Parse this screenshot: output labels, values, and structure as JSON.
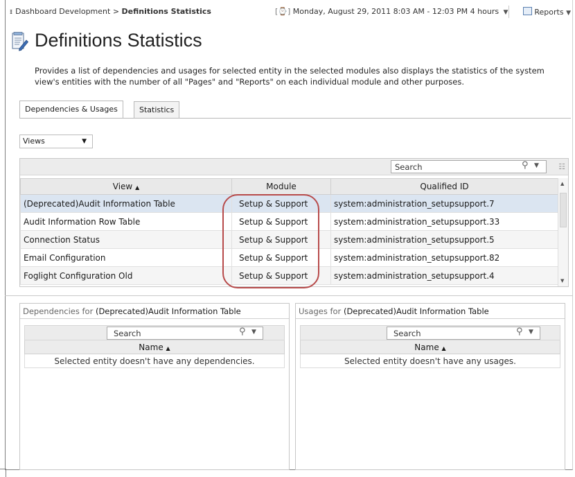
{
  "breadcrumb": {
    "parent": "Dashboard Development",
    "separator": ">",
    "current": "Definitions Statistics",
    "icon": "breadcrumb-tree-icon"
  },
  "time_range": {
    "icon": "clock-icon",
    "text": "Monday, August 29, 2011 8:03 AM - 12:03 PM 4 hours"
  },
  "reports": {
    "icon": "reports-icon",
    "label": "Reports"
  },
  "page": {
    "icon": "definitions-report-icon",
    "title": "Definitions Statistics",
    "description": "Provides a list of dependencies and usages for selected entity in the selected modules also displays the statistics of the system view's entities with the number of all \"Pages\" and \"Reports\" on each individual module and other purposes."
  },
  "tabs": [
    {
      "label": "Dependencies & Usages",
      "active": true
    },
    {
      "label": "Statistics",
      "active": false
    }
  ],
  "views_select": {
    "value": "Views"
  },
  "main_grid": {
    "search_placeholder": "Search",
    "columns": [
      "View",
      "Module",
      "Qualified ID"
    ],
    "sort_column": "View",
    "rows": [
      {
        "view": "(Deprecated)Audit Information Table",
        "module": "Setup & Support",
        "qid": "system:administration_setupsupport.7"
      },
      {
        "view": "Audit Information Row Table",
        "module": "Setup & Support",
        "qid": "system:administration_setupsupport.33"
      },
      {
        "view": "Connection Status",
        "module": "Setup & Support",
        "qid": "system:administration_setupsupport.5"
      },
      {
        "view": "Email Configuration",
        "module": "Setup & Support",
        "qid": "system:administration_setupsupport.82"
      },
      {
        "view": "Foglight Configuration Old",
        "module": "Setup & Support",
        "qid": "system:administration_setupsupport.4"
      }
    ]
  },
  "dependencies_panel": {
    "label": "Dependencies for",
    "entity": "(Deprecated)Audit Information Table",
    "search_placeholder": "Search",
    "column": "Name",
    "empty_text": "Selected entity doesn't have any dependencies."
  },
  "usages_panel": {
    "label": "Usages for",
    "entity": "(Deprecated)Audit Information Table",
    "search_placeholder": "Search",
    "column": "Name",
    "empty_text": "Selected entity doesn't have any usages."
  },
  "colors": {
    "highlight_oval": "#b74a4a",
    "selected_row": "#dbe5f1",
    "header_bg": "#e9e9e9"
  }
}
